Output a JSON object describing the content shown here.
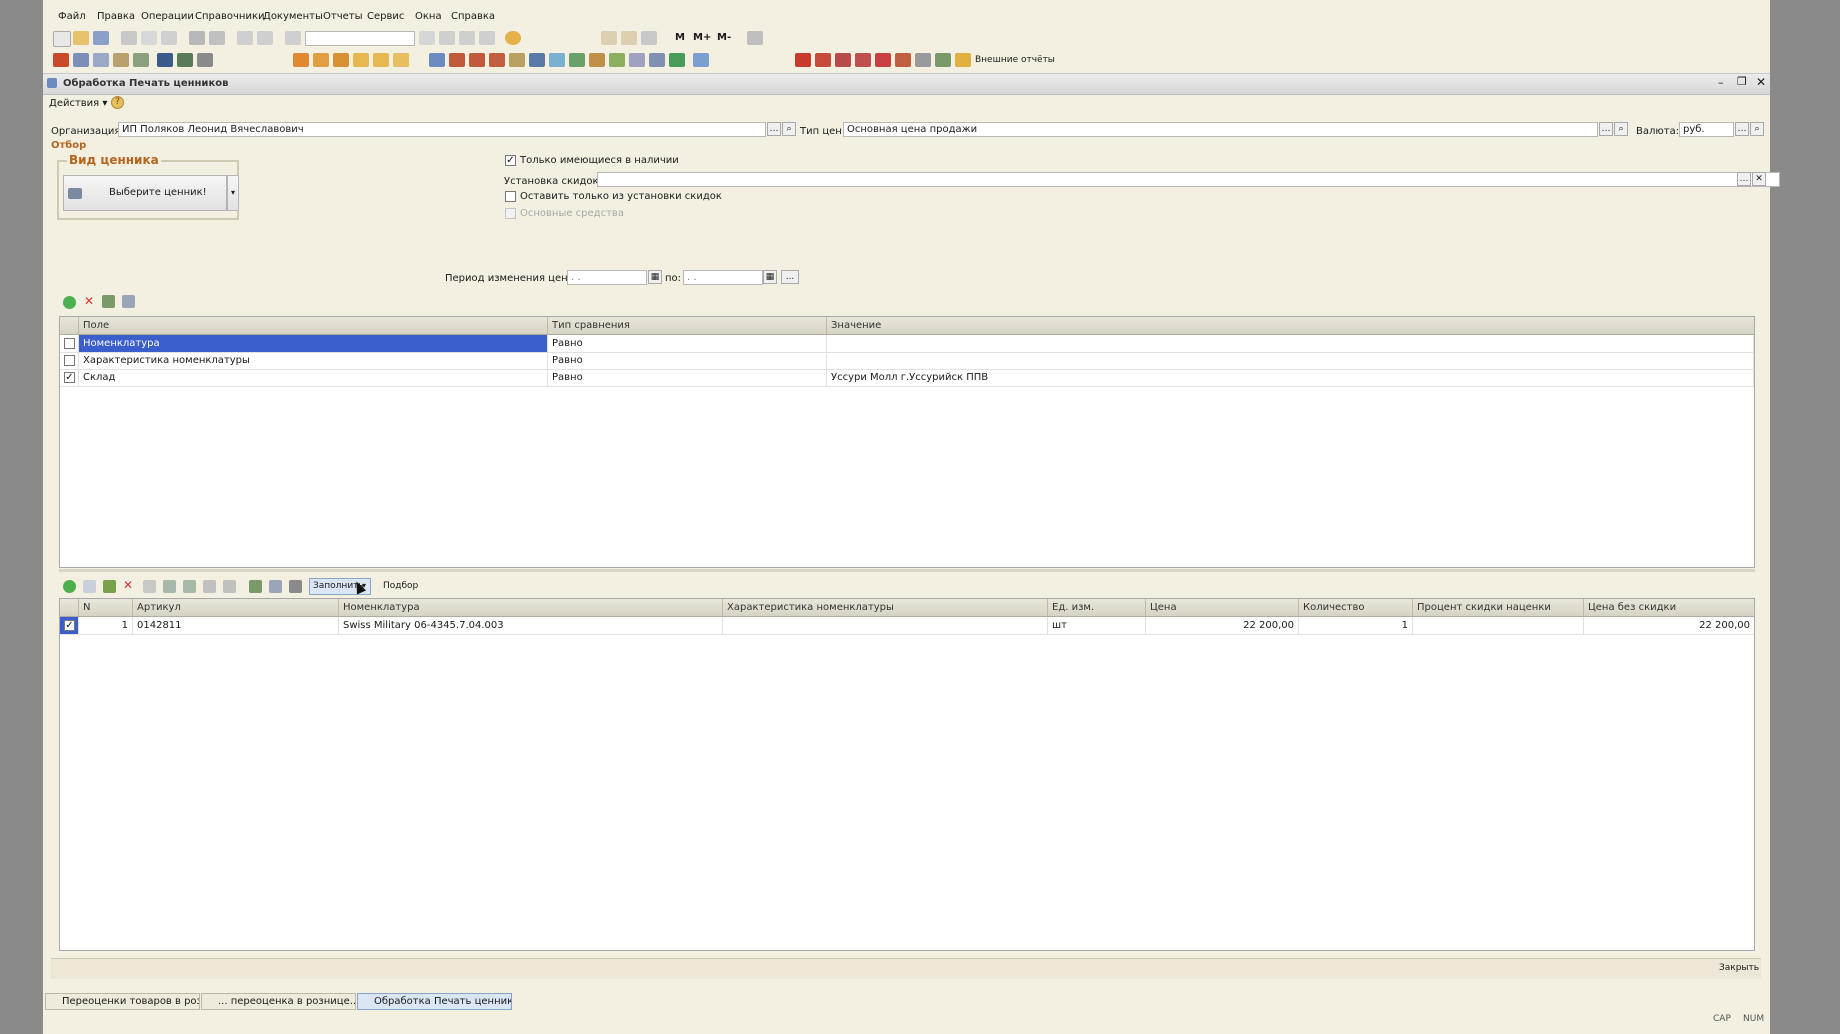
{
  "menu": [
    "Файл",
    "Правка",
    "Операции",
    "Справочники",
    "Документы",
    "Отчеты",
    "Сервис",
    "Окна",
    "Справка"
  ],
  "toolbar": {
    "external_reports": "Внешние отчёты",
    "memory_buttons": [
      "M",
      "M+",
      "M-"
    ]
  },
  "window": {
    "title": "Обработка  Печать ценников",
    "actions_label": "Действия"
  },
  "form": {
    "org_label": "Организация:",
    "org_value": "ИП Поляков Леонид Вячеславович",
    "price_type_label": "Тип цен:",
    "price_type_value": "Основная цена продажи",
    "currency_label": "Валюта:",
    "currency_value": "руб.",
    "filter_label": "Отбор",
    "tag_group_label": "Вид ценника",
    "tag_button_label": "Выберите ценник!",
    "only_in_stock_label": "Только имеющиеся в наличии",
    "only_in_stock_checked": true,
    "discount_label": "Установка скидок:",
    "leave_only_label": "Оставить только из установки скидок",
    "fixed_assets_label": "Основные средства",
    "period_label": "Период изменения цен с:",
    "period_from": ". .",
    "period_to_label": "по:",
    "period_to": ". .",
    "more_button": "..."
  },
  "filter_table": {
    "columns": [
      "Поле",
      "Тип сравнения",
      "Значение"
    ],
    "rows": [
      {
        "checked": false,
        "field": "Номенклатура",
        "compare": "Равно",
        "value": ""
      },
      {
        "checked": false,
        "field": "Характеристика номенклатуры",
        "compare": "Равно",
        "value": ""
      },
      {
        "checked": true,
        "field": "Склад",
        "compare": "Равно",
        "value": "Уссури Молл  г.Уссурийск ППВ"
      }
    ]
  },
  "items_toolbar": {
    "fill_label": "Заполнить",
    "pick_label": "Подбор"
  },
  "items_table": {
    "columns": [
      "N",
      "Артикул",
      "Номенклатура",
      "Характеристика номенклатуры",
      "Ед. изм.",
      "Цена",
      "Количество",
      "Процент скидки наценки",
      "Цена без скидки"
    ],
    "rows": [
      {
        "checked": true,
        "n": "1",
        "article": "0142811",
        "name": "Swiss Military  06-4345.7.04.003",
        "char": "",
        "unit": "шт",
        "price": "22 200,00",
        "qty": "1",
        "pct": "",
        "price_no_disc": "22 200,00"
      }
    ]
  },
  "footer": {
    "close_label": "Закрыть"
  },
  "taskbar": [
    "Переоценки товаров в роз...",
    "... переоценка в рознице...",
    "Обработка  Печать ценников"
  ],
  "status": [
    "CAP",
    "NUM"
  ],
  "colors": {
    "selection": "#3a5fcd",
    "background": "#f3efe1",
    "group_title": "#b5651d"
  }
}
